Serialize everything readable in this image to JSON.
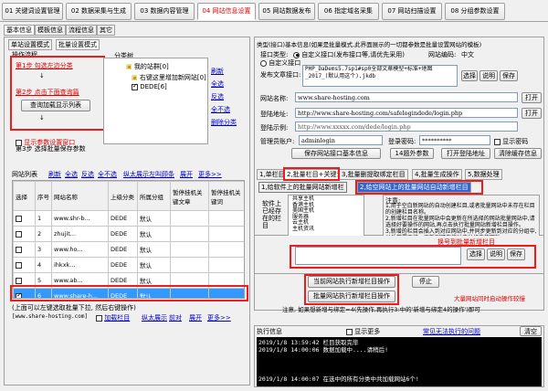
{
  "main_tabs": [
    "01 关键词设置管理",
    "02 数据采集与生成",
    "03 数据内容管理",
    "04 网站信息设置",
    "05 网站数据发布",
    "06 指定域名采集",
    "07 网站扫描设置",
    "08 分组参数设置"
  ],
  "sub_tabs": [
    "基本信息",
    "模板信息",
    "流程信息",
    "其它"
  ],
  "left": {
    "mode_tabs": [
      "单站设置模式",
      "批量设置模式"
    ],
    "flow_label": "操作流程",
    "step1": "第1步  勾选左边分类",
    "step2": "第2步  点击下面查询篇",
    "query_btn": "查询加载显示列表",
    "step3": "第3步  选择批量保存参数",
    "show_param": "显示参数设置窗口",
    "category_group": "分类树",
    "tree_root": "我的站群[0]",
    "tree_child1": "右键这里增加新网站[0]",
    "tree_child2": "DEDE[6]",
    "tree_actions": [
      "刷新",
      "全选",
      "反选",
      "全不选",
      "删除分类"
    ],
    "list_label": "网站列表",
    "list_actions": [
      "刷新",
      "全选",
      "反选",
      "全不选",
      "纵太展示",
      "左叫顾条",
      "展开",
      "更多>>"
    ],
    "columns": [
      "选择",
      "序号",
      "网站名称",
      "上级分类",
      "所属分组",
      "暂停挂机关键文章",
      "暂停挂机关键词"
    ],
    "rows": [
      {
        "n": "1",
        "name": "www.shr-b...",
        "cat": "DEDE",
        "grp": "默认",
        "checked": false
      },
      {
        "n": "2",
        "name": "zhujit...",
        "cat": "DEDE",
        "grp": "默认",
        "checked": false
      },
      {
        "n": "3",
        "name": "www.ho...",
        "cat": "DEDE",
        "grp": "默认",
        "checked": false
      },
      {
        "n": "4",
        "name": "ihkxk...",
        "cat": "DEDE",
        "grp": "默认",
        "checked": false
      },
      {
        "n": "5",
        "name": "www.ab...",
        "cat": "DEDE",
        "grp": "默认",
        "checked": false
      },
      {
        "n": "6",
        "name": "www.share-h...",
        "cat": "DEDE",
        "grp": "默认",
        "checked": true
      }
    ],
    "bottom_hint": "(上面可以左键选取批量下拉, 然后右键操作)",
    "status_site": "[www.share-hosting.com]",
    "bottom_actions": [
      "加载栏目",
      "纵太展示",
      "前对",
      "展开",
      "更多>>"
    ]
  },
  "right": {
    "title": "类型(接口)基本信息(如果是批量模式,此界面展示的一切都参数是批量设置网站的模板)",
    "publish_label": "接口类型:",
    "radio1": "自定义接口(发布接口等,请优先采用)",
    "radio2": "自定义接口",
    "encoding_label": "网站编码:",
    "encoding_value": "中文",
    "file_label": "发布文章接口:",
    "file_value": "PHP_DaDems5.7sp1#sp0全部文章模型+标准+地图_2017_(默认用这个).jkdb",
    "btn_select": "选择",
    "btn_desc": "说明",
    "btn_save": "保存",
    "site_name_label": "网站名称:",
    "site_name": "www.share-hosting.com",
    "btn_open": "打开",
    "site_url_label": "登陆地址:",
    "site_url": "http://www.share-hosting.com/safelogindede/login.php",
    "login_url_label": "登陆示例:",
    "login_url": "http://www.xxxxx.com/dede/login.php",
    "user_label": "管理员账户:",
    "user": "adminlogin",
    "pass_label": "登录密码:",
    "pass": "**********",
    "show_pass": "显示密码",
    "btn_save_basic": "保存网站接口基本信息",
    "btn_batch": "14题外参数",
    "btn_open_login": "打开登陆地址",
    "btn_clear": "清除缓存信息",
    "info_tabs": [
      "1,单栏目",
      "2,批量栏目+关键词",
      "3,批量删提取绑定栏目",
      "4,批量生成操作",
      "5,数据处理"
    ],
    "sub_tab_a": "1,给软件上的批量网站新增栏",
    "sub_tab_b": "2,给空网站上的批量网站自动新增栏目",
    "soft_label": "软件上已经存在的栏目",
    "items": [
      "共享主机",
      "香港主机",
      "美国主机",
      "服务器",
      "云主机",
      "主机资讯"
    ],
    "note_title": "注意:",
    "notes": [
      "1,用于空白新网站的自动创建栏目,或者批量网站中未存在栏目的创建栏目名称。",
      "2,新增栏目在批量网站中会更新在所选择的网站批量网站中,请选择好要操作的网站,再点击执行批量网站新增栏目操作。",
      "3,新增的栏目会插入到对应网站中,并同步更新到对应的分组中,以后若需再统一更新则可直接对应分组内的网站。",
      "4,也可以手动在右侧输入新增栏目名称进行添加。"
    ],
    "batch_label": "换号到批量新增栏目",
    "btn_run": "当前网站执行新增栏目操作",
    "btn_stop": "停止",
    "btn_batch_run": "批量网站执行新增栏目操作",
    "batch_hint": "大量网站同时启动操作较慢",
    "notice": "注意, 如果想新增与绑定=4(先操作,再执行3:中的'新增与绑定4的操作')即可",
    "log_title": "执行信息",
    "show_more": "显示更多",
    "log_link": "常见无法执行的问题",
    "btn_log_clear": "清空",
    "logs": [
      "2019/1/8 13:59:42   栏目获取完毕",
      "2019/1/8 14:00:06   数据加载中....请稍后!",
      "",
      "",
      "",
      "2019/1/8 14:00:07   在选中的所有分类中共加载网站6个!"
    ]
  },
  "colors": {
    "accent_red": "#e00000",
    "link_blue": "#0000cc",
    "selection": "#3399ff",
    "callout": "#ee1c1c"
  }
}
